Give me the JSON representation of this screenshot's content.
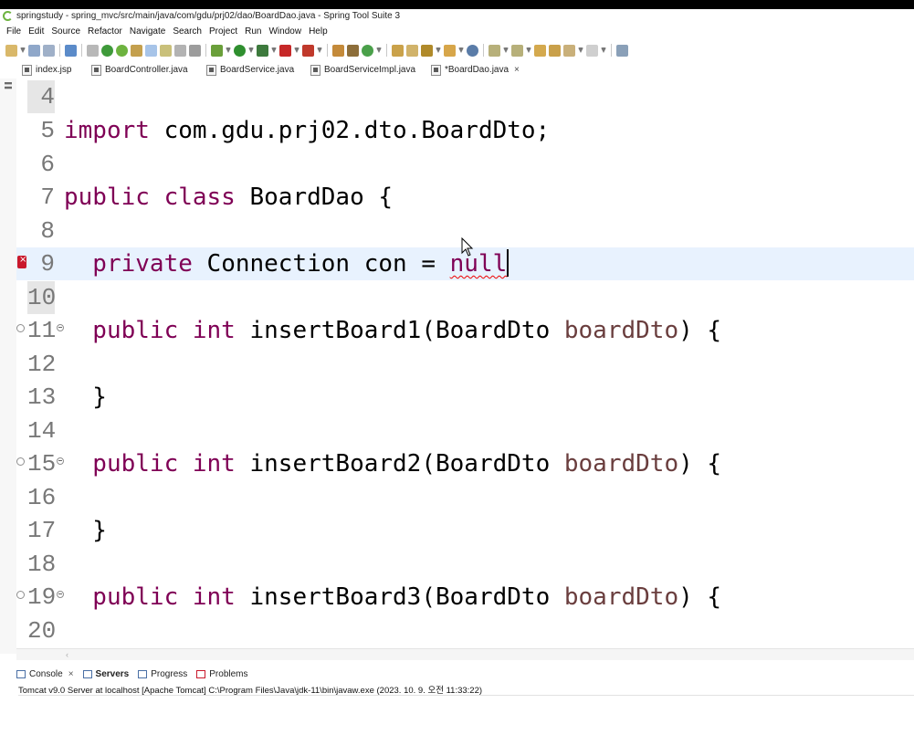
{
  "window": {
    "title": "springstudy - spring_mvc/src/main/java/com/gdu/prj02/dao/BoardDao.java - Spring Tool Suite 3"
  },
  "menu": [
    "File",
    "Edit",
    "Source",
    "Refactor",
    "Navigate",
    "Search",
    "Project",
    "Run",
    "Window",
    "Help"
  ],
  "tabs": [
    {
      "label": "index.jsp",
      "active": false
    },
    {
      "label": "BoardController.java",
      "active": false
    },
    {
      "label": "BoardService.java",
      "active": false
    },
    {
      "label": "BoardServiceImpl.java",
      "active": false
    },
    {
      "label": "*BoardDao.java",
      "active": true,
      "close": "×"
    }
  ],
  "editor": {
    "lines": [
      {
        "num": "4",
        "text": ""
      },
      {
        "num": "5",
        "kw": "import",
        "rest": " com.gdu.prj02.dto.BoardDto;"
      },
      {
        "num": "6",
        "text": ""
      },
      {
        "num": "7",
        "kw": "public class",
        "rest": " BoardDao {"
      },
      {
        "num": "8",
        "text": ""
      },
      {
        "num": "9",
        "kw": "  private",
        "rest": " Connection con = ",
        "error_word": "null",
        "has_error": true
      },
      {
        "num": "10",
        "text": ""
      },
      {
        "num": "11",
        "kw": "  public int",
        "rest": " insertBoard1(BoardDto ",
        "param": "boardDto",
        "tail": ") {"
      },
      {
        "num": "12",
        "text": ""
      },
      {
        "num": "13",
        "text": "  }"
      },
      {
        "num": "14",
        "text": ""
      },
      {
        "num": "15",
        "kw": "  public int",
        "rest": " insertBoard2(BoardDto ",
        "param": "boardDto",
        "tail": ") {"
      },
      {
        "num": "16",
        "text": ""
      },
      {
        "num": "17",
        "text": "  }"
      },
      {
        "num": "18",
        "text": ""
      },
      {
        "num": "19",
        "kw": "  public int",
        "rest": " insertBoard3(BoardDto ",
        "param": "boardDto",
        "tail": ") {"
      },
      {
        "num": "20",
        "text": ""
      }
    ]
  },
  "bottom_panel": {
    "tabs": [
      {
        "label": "Console",
        "close": "×"
      },
      {
        "label": "Servers",
        "bold": true
      },
      {
        "label": "Progress"
      },
      {
        "label": "Problems"
      }
    ],
    "console_text": "Tomcat v9.0 Server at localhost [Apache Tomcat] C:\\Program Files\\Java\\jdk-11\\bin\\javaw.exe  (2023. 10. 9. 오전 11:33:22)"
  },
  "colors": {
    "keyword": "#7f0055",
    "parameter": "#6a3e3e",
    "current_line": "#e8f2fe",
    "error": "#c9182b"
  }
}
